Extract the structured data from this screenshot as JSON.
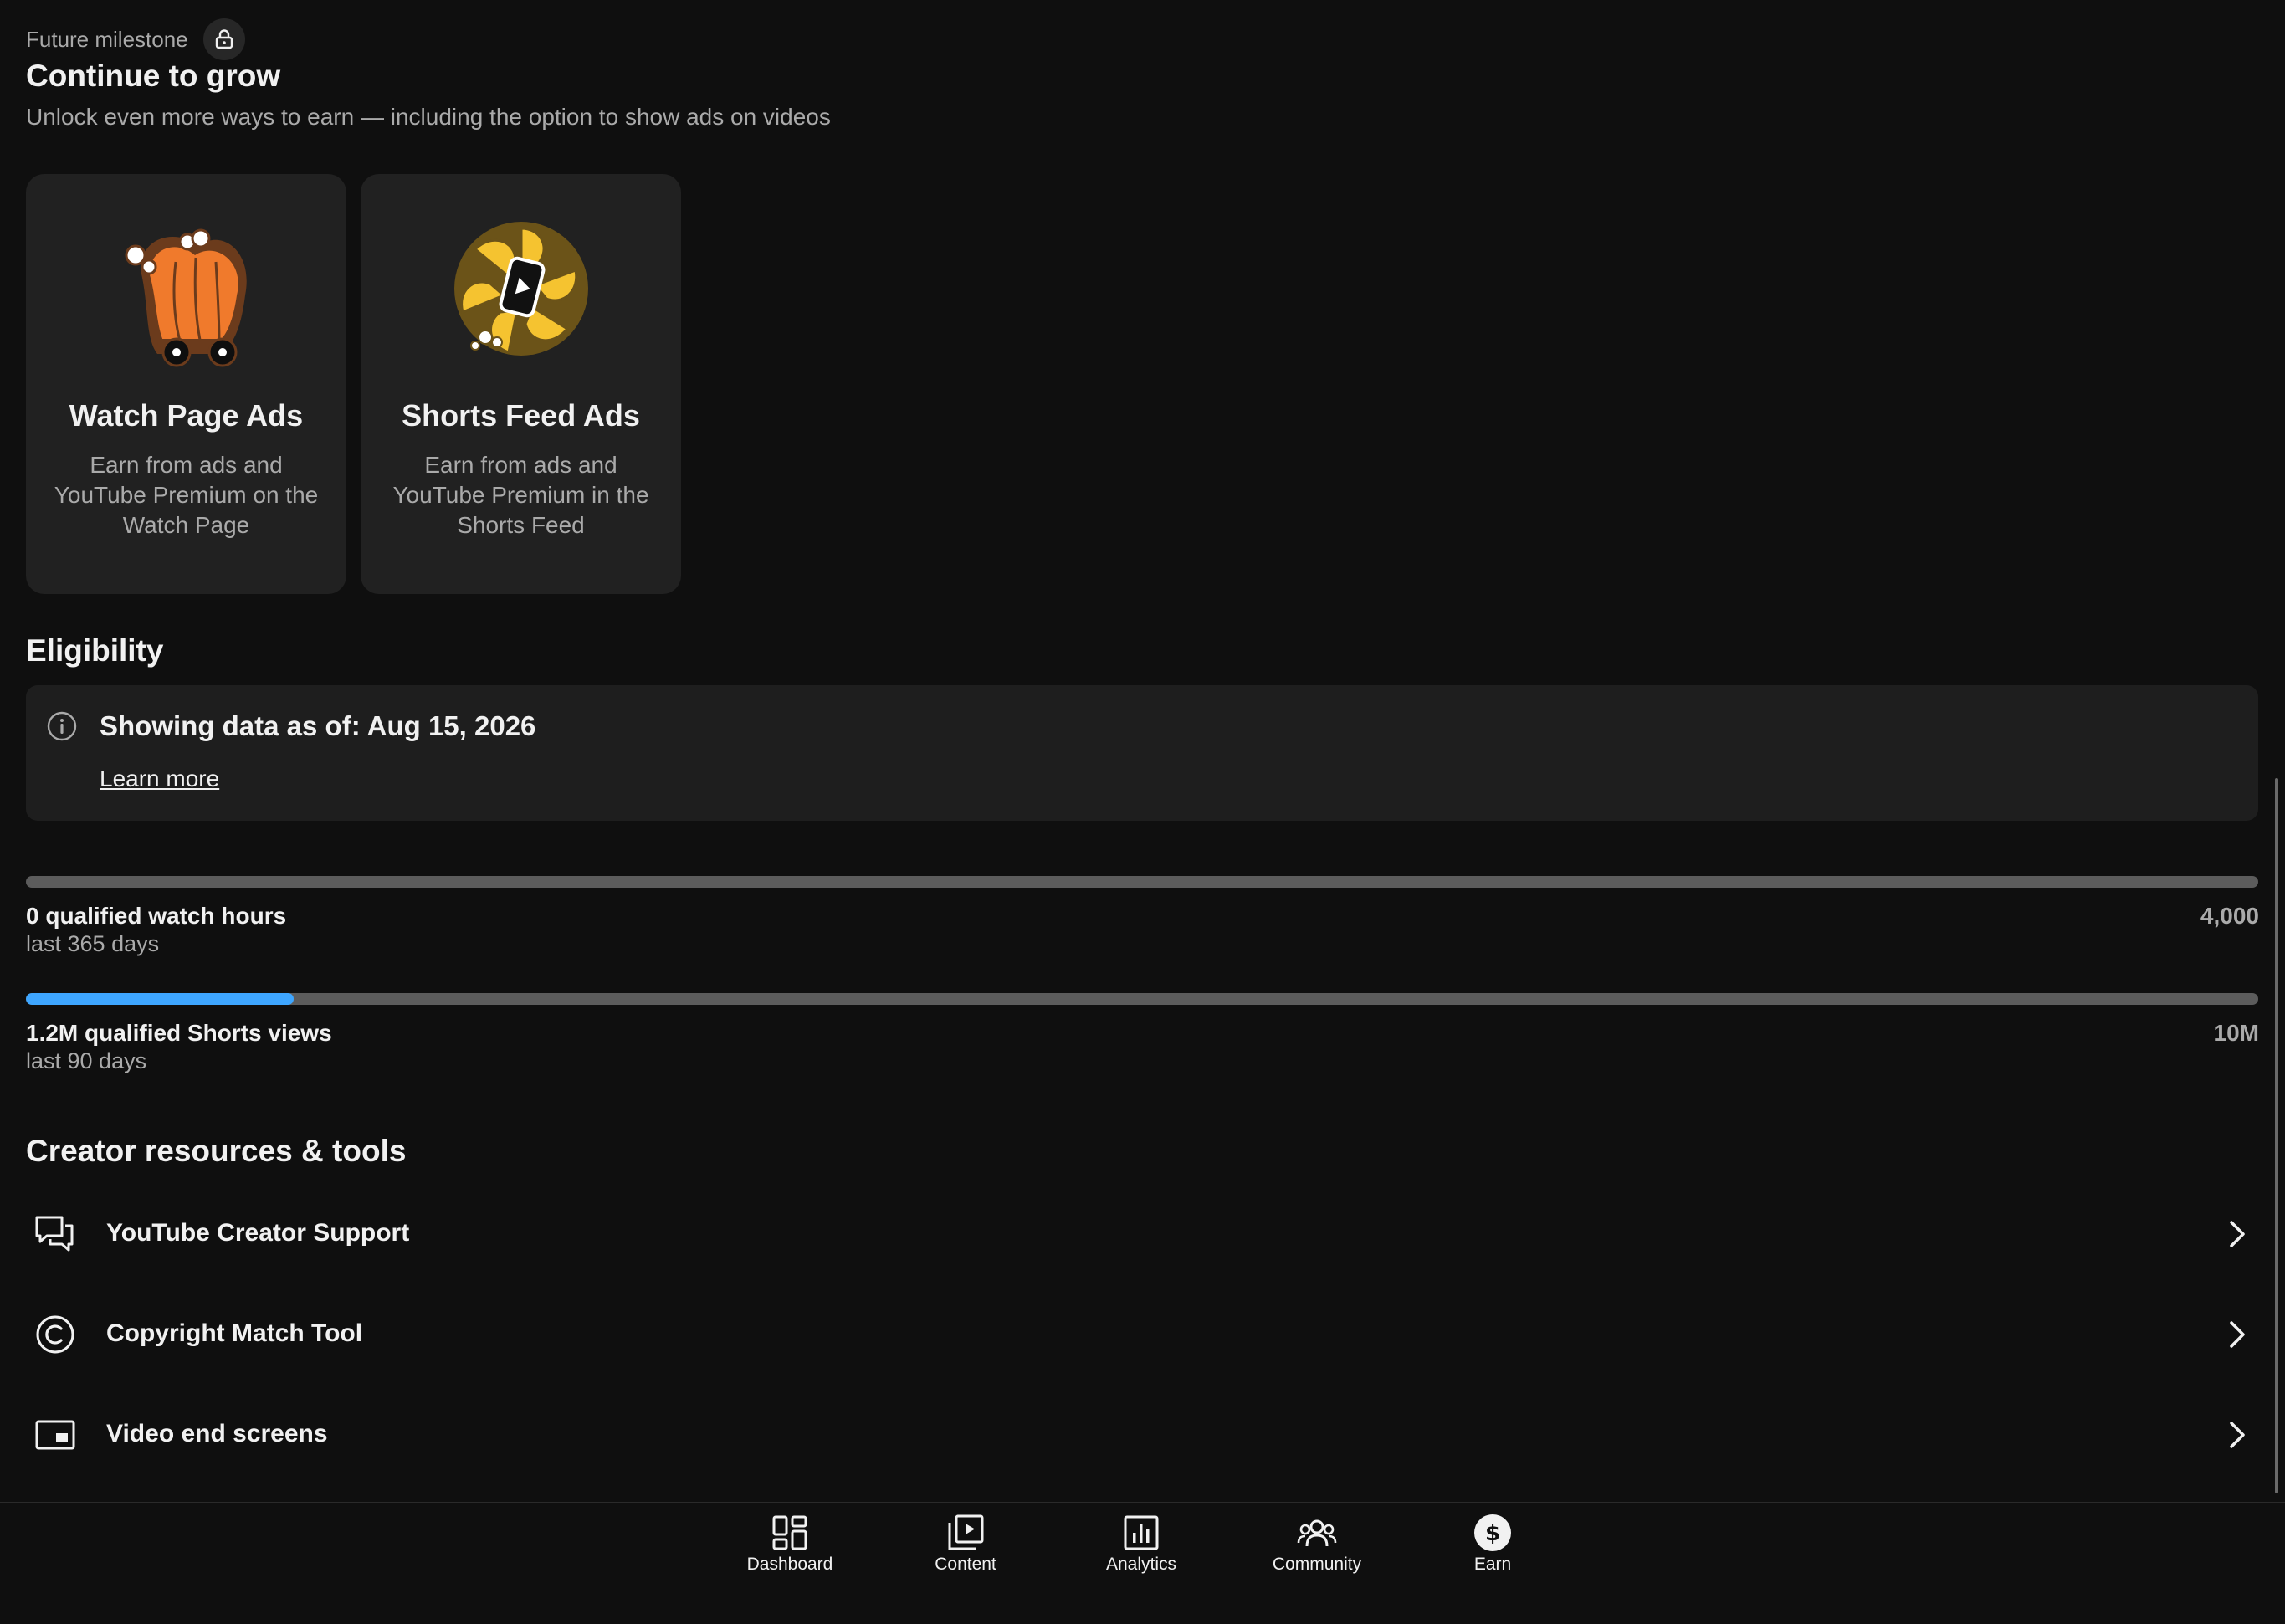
{
  "milestone": {
    "label": "Future milestone",
    "lock_icon": "lock-icon",
    "title": "Continue to grow",
    "subtitle": "Unlock even more ways to earn — including the option to show ads on videos"
  },
  "cards": [
    {
      "illustration": "watch-page-ads-illustration",
      "title": "Watch Page Ads",
      "description": "Earn from ads and YouTube Premium on the Watch Page"
    },
    {
      "illustration": "shorts-feed-ads-illustration",
      "title": "Shorts Feed Ads",
      "description": "Earn from ads and YouTube Premium in the Shorts Feed"
    }
  ],
  "eligibility": {
    "title": "Eligibility",
    "info_icon": "info-icon",
    "info_text": "Showing data as of: Aug 15, 2026",
    "learn_more": "Learn more"
  },
  "metrics": [
    {
      "label": "0 qualified watch hours",
      "period": "last 365 days",
      "target": "4,000",
      "progress_fraction": 0.0
    },
    {
      "label": "1.2M qualified Shorts views",
      "period": "last 90 days",
      "target": "10M",
      "progress_fraction": 0.12
    }
  ],
  "resources": {
    "title": "Creator resources & tools",
    "items": [
      {
        "icon": "chat-bubbles-icon",
        "label": "YouTube Creator Support"
      },
      {
        "icon": "copyright-icon",
        "label": "Copyright Match Tool"
      },
      {
        "icon": "end-screen-icon",
        "label": "Video end screens"
      }
    ],
    "chevron_icon": "chevron-right-icon"
  },
  "bottom_nav": {
    "items": [
      {
        "label": "Dashboard",
        "icon": "dashboard-icon",
        "active": false
      },
      {
        "label": "Content",
        "icon": "content-icon",
        "active": false
      },
      {
        "label": "Analytics",
        "icon": "analytics-icon",
        "active": false
      },
      {
        "label": "Community",
        "icon": "community-icon",
        "active": false
      },
      {
        "label": "Earn",
        "icon": "earn-dollar-icon",
        "active": true
      }
    ]
  },
  "colors": {
    "background": "#0f0f0f",
    "card": "#212121",
    "progress_fill": "#3ea6ff",
    "progress_track": "#5c5c5c",
    "secondary_text": "#aaaaaa"
  }
}
